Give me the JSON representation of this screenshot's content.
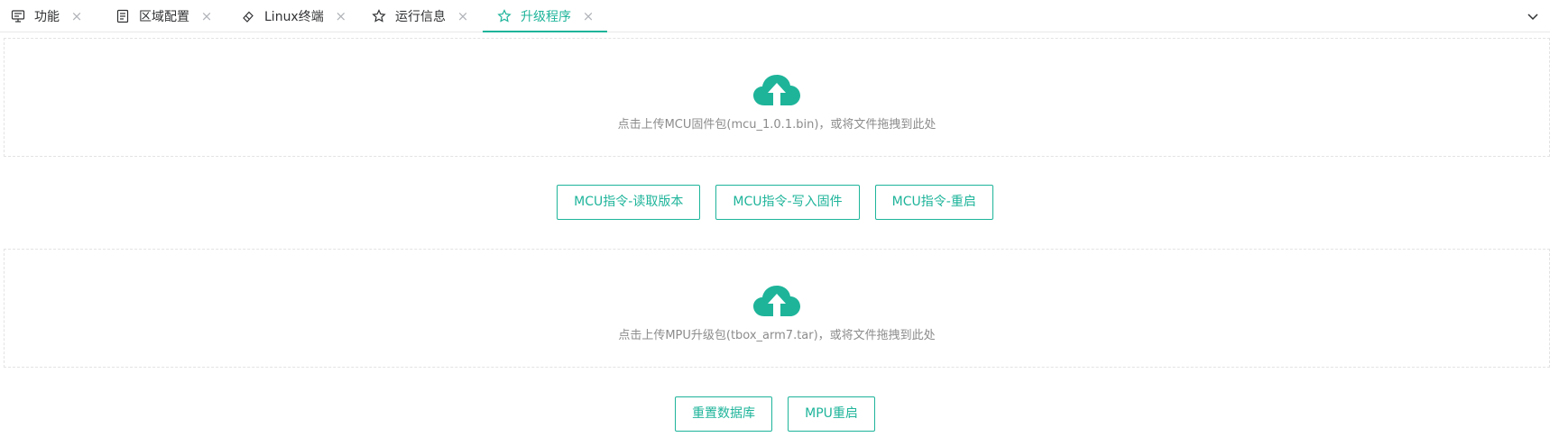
{
  "tabs": [
    {
      "label": "功能",
      "icon": "monitor-icon",
      "active": false
    },
    {
      "label": "区域配置",
      "icon": "document-icon",
      "active": false
    },
    {
      "label": "Linux终端",
      "icon": "eraser-icon",
      "active": false
    },
    {
      "label": "运行信息",
      "icon": "star-icon",
      "active": false
    },
    {
      "label": "升级程序",
      "icon": "star-icon",
      "active": true
    }
  ],
  "tab_close_glyph": "×",
  "mcu_upload": {
    "icon": "cloud-upload-icon",
    "text": "点击上传MCU固件包(mcu_1.0.1.bin)，或将文件拖拽到此处"
  },
  "mcu_buttons": {
    "read_version": "MCU指令-读取版本",
    "write_firmware": "MCU指令-写入固件",
    "restart": "MCU指令-重启"
  },
  "mpu_upload": {
    "icon": "cloud-upload-icon",
    "text": "点击上传MPU升级包(tbox_arm7.tar)，或将文件拖拽到此处"
  },
  "mpu_buttons": {
    "reset_db": "重置数据库",
    "restart": "MPU重启"
  },
  "colors": {
    "accent": "#1eb49a",
    "text": "#303133",
    "muted": "#8c8c8c"
  }
}
